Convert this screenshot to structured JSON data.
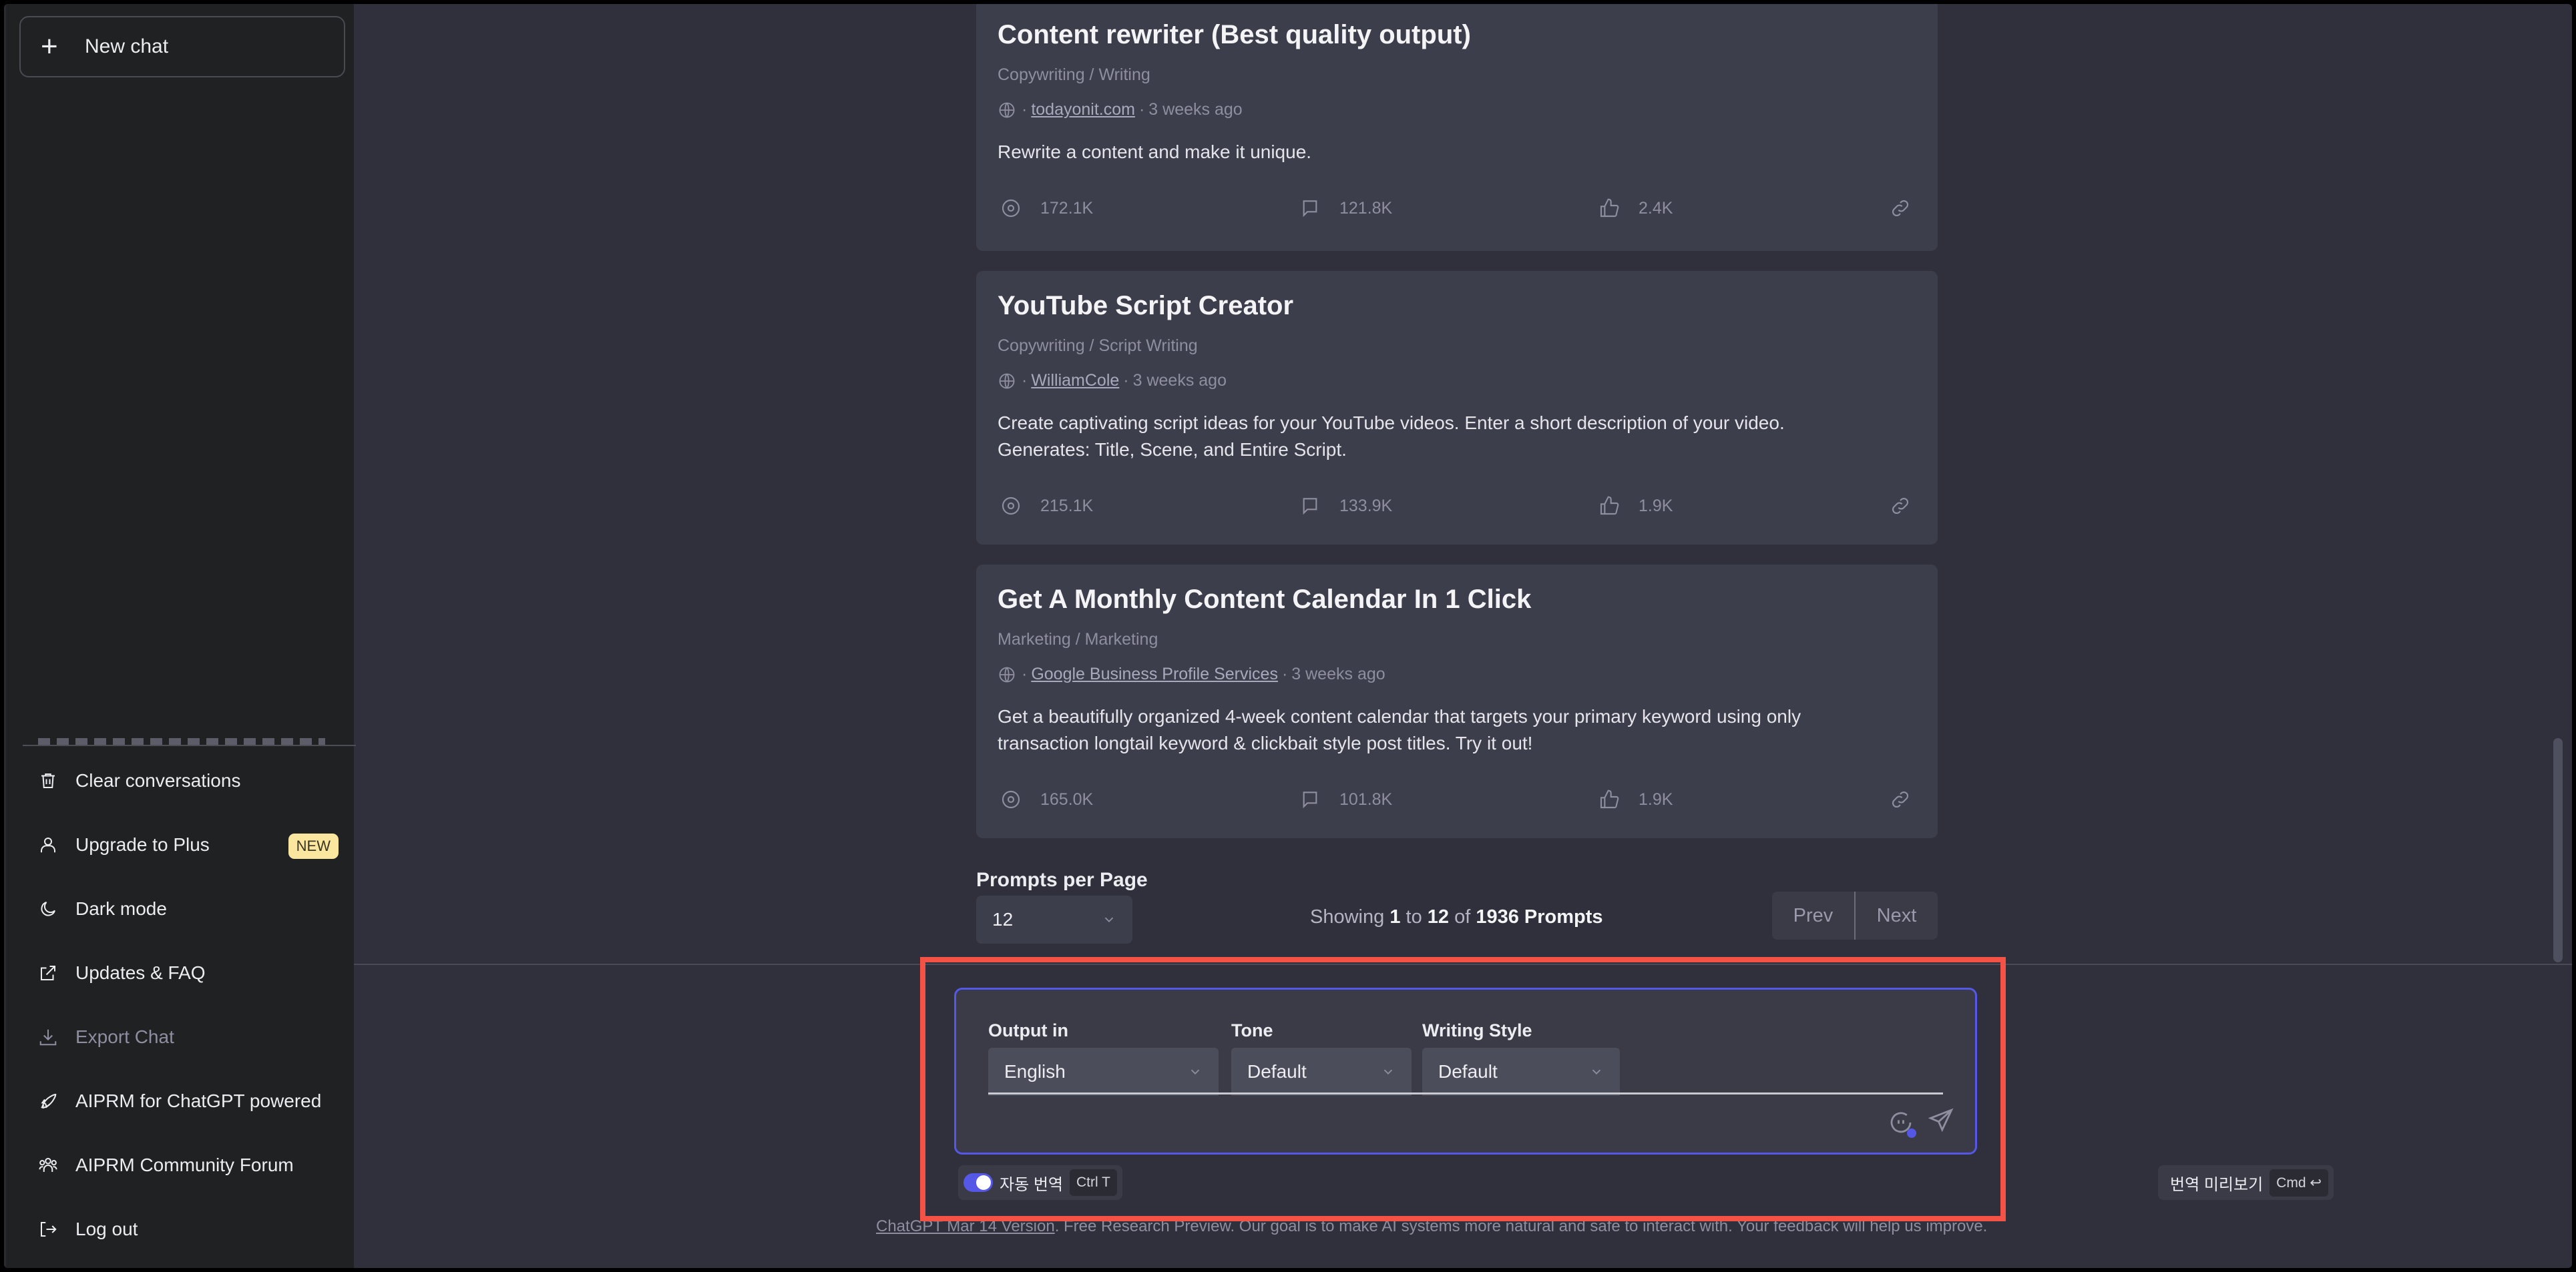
{
  "sidebar": {
    "new_chat_label": "New chat",
    "menu": [
      {
        "label": "Clear conversations",
        "icon": "trash-icon"
      },
      {
        "label": "Upgrade to Plus",
        "icon": "user-icon",
        "badge": "NEW"
      },
      {
        "label": "Dark mode",
        "icon": "moon-icon"
      },
      {
        "label": "Updates & FAQ",
        "icon": "external-link-icon"
      },
      {
        "label": "Export Chat",
        "icon": "download-icon",
        "disabled": true
      },
      {
        "label": "AIPRM for ChatGPT powered",
        "icon": "rocket-icon"
      },
      {
        "label": "AIPRM Community Forum",
        "icon": "users-icon"
      },
      {
        "label": "Log out",
        "icon": "logout-icon"
      }
    ]
  },
  "prompts": [
    {
      "title": "Content rewriter (Best quality output)",
      "category": "Copywriting / Writing",
      "author": "todayonit.com",
      "age": "3 weeks ago",
      "description": "Rewrite a content and make it unique.",
      "views": "172.1K",
      "comments": "121.8K",
      "likes": "2.4K"
    },
    {
      "title": "YouTube Script Creator",
      "category": "Copywriting / Script Writing",
      "author": "WilliamCole",
      "age": "3 weeks ago",
      "description": "Create captivating script ideas for your YouTube videos. Enter a short description of your video. Generates: Title, Scene, and Entire Script.",
      "views": "215.1K",
      "comments": "133.9K",
      "likes": "1.9K"
    },
    {
      "title": "Get A Monthly Content Calendar In 1 Click",
      "category": "Marketing / Marketing",
      "author": "Google Business Profile Services",
      "age": "3 weeks ago",
      "description": "Get a beautifully organized 4-week content calendar that targets your primary keyword using only transaction longtail keyword & clickbait style post titles. Try it out!",
      "views": "165.0K",
      "comments": "101.8K",
      "likes": "1.9K"
    }
  ],
  "pagination": {
    "per_page_label": "Prompts per Page",
    "per_page_value": "12",
    "showing_prefix": "Showing",
    "from": "1",
    "to_word": "to",
    "to": "12",
    "of_word": "of",
    "total": "1936 Prompts",
    "prev_label": "Prev",
    "next_label": "Next"
  },
  "composer": {
    "output_label": "Output in",
    "output_value": "English",
    "tone_label": "Tone",
    "tone_value": "Default",
    "style_label": "Writing Style",
    "style_value": "Default",
    "auto_translate_label": "자동 번역",
    "auto_translate_on": true,
    "auto_translate_shortcut": "Ctrl T",
    "preview_label": "번역 미리보기",
    "preview_shortcut": "Cmd ↩"
  },
  "footer": {
    "version_link": "ChatGPT Mar 14 Version",
    "text": ". Free Research Preview. Our goal is to make AI systems more natural and safe to interact with. Your feedback will help us improve."
  },
  "colors": {
    "accent": "#5558e6",
    "highlight_box": "#f55246",
    "badge_bg": "#fae69e"
  }
}
